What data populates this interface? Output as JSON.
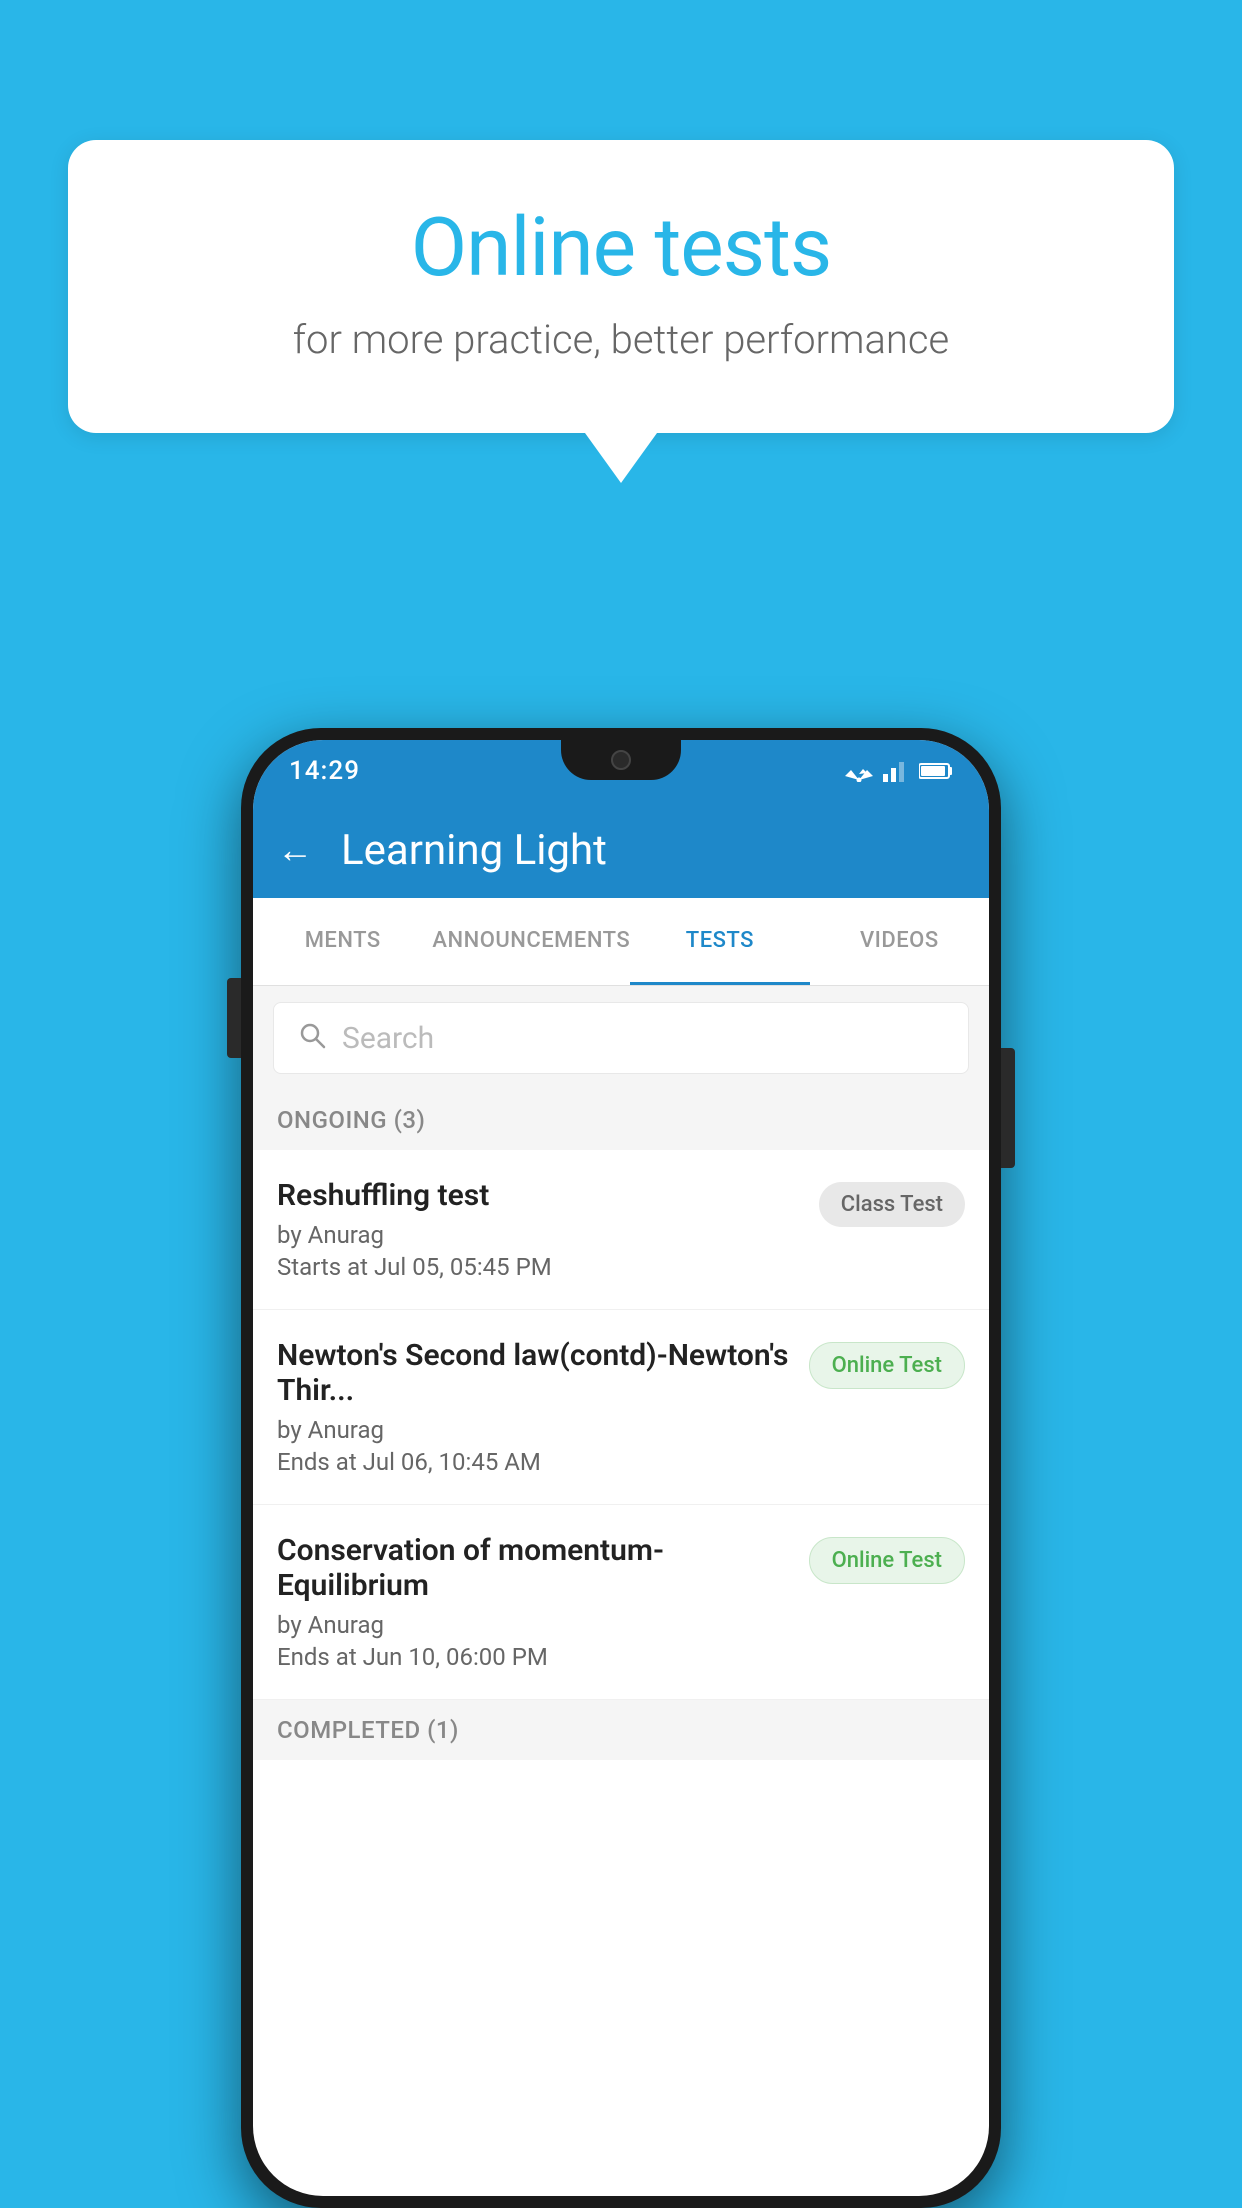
{
  "background_color": "#29b6e8",
  "speech_bubble": {
    "title": "Online tests",
    "subtitle": "for more practice, better performance"
  },
  "phone": {
    "status_bar": {
      "time": "14:29"
    },
    "app_bar": {
      "title": "Learning Light",
      "back_label": "←"
    },
    "tabs": [
      {
        "label": "MENTS",
        "active": false
      },
      {
        "label": "ANNOUNCEMENTS",
        "active": false
      },
      {
        "label": "TESTS",
        "active": true
      },
      {
        "label": "VIDEOS",
        "active": false
      }
    ],
    "search": {
      "placeholder": "Search"
    },
    "ongoing": {
      "section_title": "ONGOING (3)",
      "items": [
        {
          "name": "Reshuffling test",
          "author": "by Anurag",
          "time_label": "Starts at",
          "time": "Jul 05, 05:45 PM",
          "badge": "Class Test",
          "badge_type": "class"
        },
        {
          "name": "Newton's Second law(contd)-Newton's Thir...",
          "author": "by Anurag",
          "time_label": "Ends at",
          "time": "Jul 06, 10:45 AM",
          "badge": "Online Test",
          "badge_type": "online"
        },
        {
          "name": "Conservation of momentum-Equilibrium",
          "author": "by Anurag",
          "time_label": "Ends at",
          "time": "Jun 10, 06:00 PM",
          "badge": "Online Test",
          "badge_type": "online"
        }
      ]
    },
    "completed": {
      "section_title": "COMPLETED (1)"
    }
  }
}
